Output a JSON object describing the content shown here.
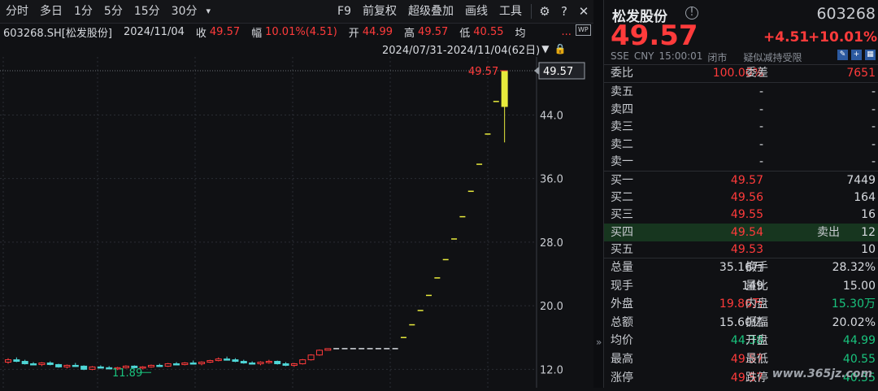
{
  "toolbar": {
    "items": [
      "分时",
      "多日",
      "1分",
      "5分",
      "15分",
      "30分"
    ],
    "dropdown": "▾",
    "right_items": [
      "F9",
      "前复权",
      "超级叠加",
      "画线",
      "工具"
    ],
    "icons": {
      "settings": "⚙",
      "help": "?",
      "close": "✕"
    }
  },
  "info": {
    "symbol": "603268.SH[松发股份]",
    "date": "2024/11/04",
    "close_label": "收",
    "close": "49.57",
    "range_label": "幅",
    "range": "10.01%(4.51)",
    "open_label": "开",
    "open": "44.99",
    "high_label": "高",
    "high": "49.57",
    "low_label": "低",
    "low": "40.55",
    "avg_label": "均",
    "more": "...",
    "wp_badge": "WP"
  },
  "date_range": "2024/07/31-2024/11/04(62日)",
  "chart_data": {
    "type": "candlestick",
    "y_ticks": [
      44.0,
      36.0,
      28.0,
      20.0,
      12.0
    ],
    "ylim": [
      10.6,
      50.9
    ],
    "high_marker": "49.57",
    "last_price_box": "49.57",
    "low_marker": "11.89",
    "candles": [
      [
        12.9,
        13.4,
        12.7,
        13.2
      ],
      [
        13.2,
        13.5,
        12.9,
        13.0
      ],
      [
        13.0,
        13.2,
        12.6,
        12.7
      ],
      [
        12.7,
        12.9,
        12.5,
        12.6
      ],
      [
        12.6,
        12.9,
        12.4,
        12.8
      ],
      [
        12.8,
        13.0,
        12.5,
        12.6
      ],
      [
        12.6,
        12.7,
        12.2,
        12.3
      ],
      [
        12.3,
        12.6,
        12.1,
        12.5
      ],
      [
        12.5,
        12.8,
        12.3,
        12.4
      ],
      [
        12.4,
        12.5,
        11.9,
        12.0
      ],
      [
        12.0,
        12.4,
        11.89,
        12.3
      ],
      [
        12.3,
        12.5,
        12.1,
        12.2
      ],
      [
        12.2,
        12.4,
        12.0,
        12.1
      ],
      [
        12.1,
        12.3,
        11.9,
        12.2
      ],
      [
        12.2,
        12.5,
        12.1,
        12.4
      ],
      [
        12.4,
        12.5,
        12.1,
        12.2
      ],
      [
        12.2,
        12.4,
        12.0,
        12.3
      ],
      [
        12.3,
        12.6,
        12.2,
        12.5
      ],
      [
        12.5,
        12.7,
        12.3,
        12.4
      ],
      [
        12.4,
        12.8,
        12.3,
        12.7
      ],
      [
        12.7,
        12.9,
        12.5,
        12.6
      ],
      [
        12.6,
        12.9,
        12.5,
        12.8
      ],
      [
        12.8,
        13.1,
        12.6,
        12.7
      ],
      [
        12.7,
        13.0,
        12.5,
        12.9
      ],
      [
        12.9,
        13.2,
        12.8,
        13.1
      ],
      [
        13.1,
        13.5,
        13.0,
        13.3
      ],
      [
        13.3,
        13.6,
        13.1,
        13.2
      ],
      [
        13.2,
        13.4,
        12.9,
        13.0
      ],
      [
        13.0,
        13.2,
        12.7,
        12.8
      ],
      [
        12.8,
        13.0,
        12.6,
        12.7
      ],
      [
        12.7,
        13.0,
        12.5,
        12.9
      ],
      [
        12.9,
        13.2,
        12.7,
        13.0
      ],
      [
        13.0,
        13.1,
        12.6,
        12.7
      ],
      [
        12.7,
        12.9,
        12.4,
        12.5
      ],
      [
        12.5,
        12.8,
        12.3,
        12.7
      ],
      [
        12.7,
        13.3,
        12.6,
        13.2
      ],
      [
        13.2,
        13.9,
        13.1,
        13.8
      ],
      [
        13.8,
        14.5,
        13.7,
        14.4
      ],
      [
        14.4,
        14.6,
        14.4,
        14.6
      ],
      [
        14.6,
        14.6,
        14.6,
        14.6
      ],
      [
        14.6,
        14.6,
        14.6,
        14.6
      ],
      [
        14.6,
        14.6,
        14.6,
        14.6
      ],
      [
        14.6,
        14.6,
        14.6,
        14.6
      ],
      [
        14.6,
        14.6,
        14.6,
        14.6
      ],
      [
        14.6,
        14.6,
        14.6,
        14.6
      ],
      [
        14.6,
        14.6,
        14.6,
        14.6
      ],
      [
        14.6,
        14.6,
        14.6,
        14.6
      ],
      [
        16.0,
        16.0,
        16.0,
        16.0
      ],
      [
        17.6,
        17.6,
        17.6,
        17.6
      ],
      [
        19.4,
        19.4,
        19.4,
        19.4
      ],
      [
        21.3,
        21.3,
        21.3,
        21.3
      ],
      [
        23.5,
        23.5,
        23.5,
        23.5
      ],
      [
        25.8,
        25.8,
        25.8,
        25.8
      ],
      [
        28.4,
        28.4,
        28.4,
        28.4
      ],
      [
        31.2,
        31.2,
        31.2,
        31.2
      ],
      [
        34.4,
        34.4,
        34.4,
        34.4
      ],
      [
        37.8,
        37.8,
        37.8,
        37.8
      ],
      [
        41.6,
        41.6,
        41.6,
        41.6
      ],
      [
        45.7,
        45.7,
        45.7,
        45.7
      ],
      [
        45.07,
        49.57,
        40.55,
        49.57
      ]
    ]
  },
  "panel": {
    "name": "松发股份",
    "code": "603268",
    "price": "49.57",
    "change": "+4.51",
    "change_pct": "+10.01%",
    "meta": [
      "SSE",
      "CNY",
      "15:00:01",
      "闭市",
      "疑似减持受限"
    ],
    "weibi_label": "委比",
    "weibi": "100.00%",
    "weicha_label": "委差",
    "weicha": "7651",
    "asks": [
      {
        "label": "卖五",
        "price": "-",
        "vol": "-"
      },
      {
        "label": "卖四",
        "price": "-",
        "vol": "-"
      },
      {
        "label": "卖三",
        "price": "-",
        "vol": "-"
      },
      {
        "label": "卖二",
        "price": "-",
        "vol": "-"
      },
      {
        "label": "卖一",
        "price": "-",
        "vol": "-"
      }
    ],
    "bids": [
      {
        "label": "买一",
        "price": "49.57",
        "tag": "",
        "vol": "7449"
      },
      {
        "label": "买二",
        "price": "49.56",
        "tag": "",
        "vol": "164"
      },
      {
        "label": "买三",
        "price": "49.55",
        "tag": "",
        "vol": "16"
      },
      {
        "label": "买四",
        "price": "49.54",
        "tag": "卖出",
        "vol": "12"
      },
      {
        "label": "买五",
        "price": "49.53",
        "tag": "",
        "vol": "10"
      }
    ],
    "stats": [
      {
        "l1": "总量",
        "v1": "35.16万",
        "c1": "white",
        "l2": "换手",
        "v2": "28.32%",
        "c2": "white"
      },
      {
        "l1": "现手",
        "v1": "149",
        "c1": "white",
        "l2": "量比",
        "v2": "15.00",
        "c2": "white"
      },
      {
        "l1": "外盘",
        "v1": "19.86万",
        "c1": "red",
        "l2": "内盘",
        "v2": "15.30万",
        "c2": "green"
      },
      {
        "l1": "总额",
        "v1": "15.60亿",
        "c1": "white",
        "l2": "振幅",
        "v2": "20.02%",
        "c2": "white"
      },
      {
        "l1": "均价",
        "v1": "44.38",
        "c1": "green",
        "l2": "开盘",
        "v2": "44.99",
        "c2": "green"
      },
      {
        "l1": "最高",
        "v1": "49.57",
        "c1": "red",
        "l2": "最低",
        "v2": "40.55",
        "c2": "green"
      },
      {
        "l1": "涨停",
        "v1": "49.57",
        "c1": "red",
        "l2": "跌停",
        "v2": "40.55",
        "c2": "green"
      }
    ]
  },
  "watermark": "www.365jz.com",
  "colors": {
    "up": "#ff3b3b",
    "down": "#19c37d",
    "flat": "#e8eb3c",
    "grid": "#2a2d33"
  }
}
